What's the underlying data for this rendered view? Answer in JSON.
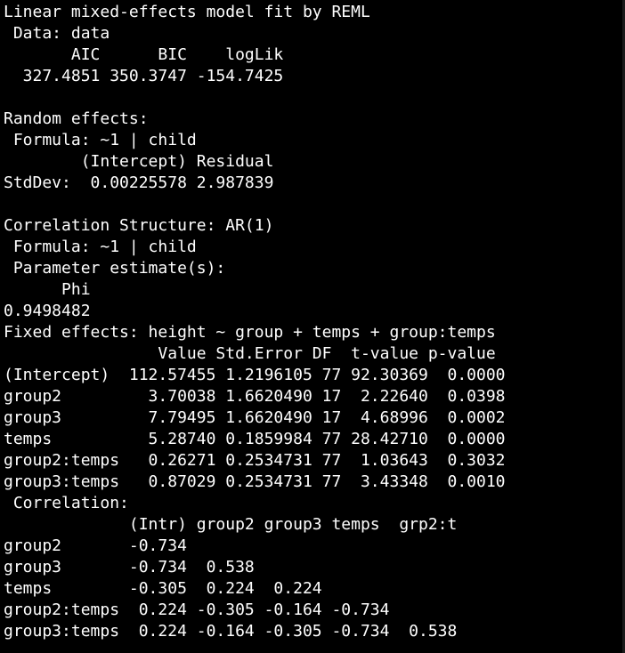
{
  "colors": {
    "background": "#000000",
    "text": "#ffffff"
  },
  "console": {
    "lines": [
      "Linear mixed-effects model fit by REML",
      " Data: data",
      "       AIC      BIC    logLik",
      "  327.4851 350.3747 -154.7425",
      "",
      "Random effects:",
      " Formula: ~1 | child",
      "        (Intercept) Residual",
      "StdDev:  0.00225578 2.987839",
      "",
      "Correlation Structure: AR(1)",
      " Formula: ~1 | child",
      " Parameter estimate(s):",
      "      Phi",
      "0.9498482",
      "Fixed effects: height ~ group + temps + group:temps",
      "                Value Std.Error DF  t-value p-value",
      "(Intercept)  112.57455 1.2196105 77 92.30369  0.0000",
      "group2         3.70038 1.6620490 17  2.22640  0.0398",
      "group3         7.79495 1.6620490 17  4.68996  0.0002",
      "temps          5.28740 0.1859984 77 28.42710  0.0000",
      "group2:temps   0.26271 0.2534731 77  1.03643  0.3032",
      "group3:temps   0.87029 0.2534731 77  3.43348  0.0010",
      " Correlation:",
      "             (Intr) group2 group3 temps  grp2:t",
      "group2       -0.734",
      "group3       -0.734  0.538",
      "temps        -0.305  0.224  0.224",
      "group2:temps  0.224 -0.305 -0.164 -0.734",
      "group3:temps  0.224 -0.164 -0.305 -0.734  0.538"
    ]
  }
}
